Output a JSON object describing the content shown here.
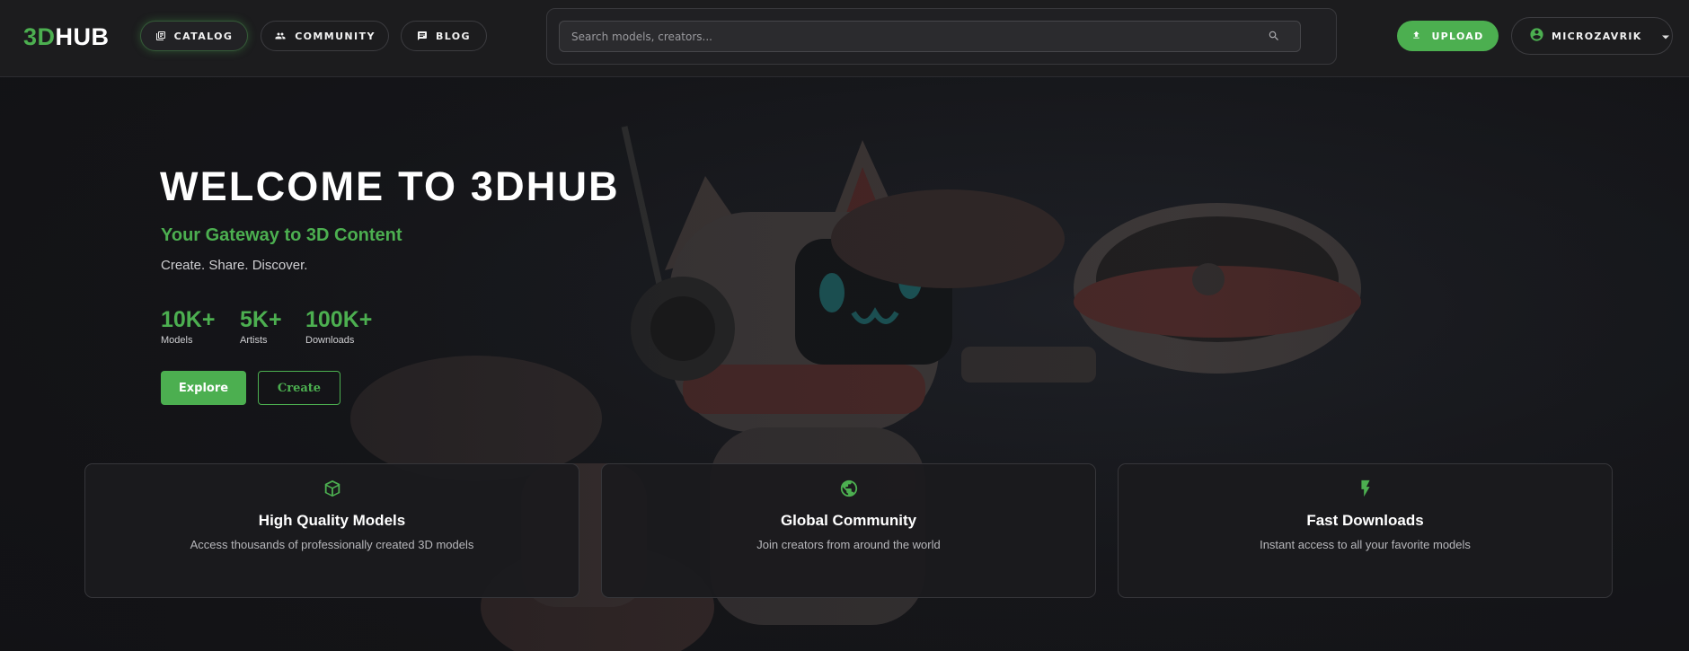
{
  "colors": {
    "accent": "#4caf50",
    "header_bg": "#1c1c1e",
    "page_bg": "#151518",
    "card_bg": "#1b1b1e",
    "text_muted": "#b7b7bb"
  },
  "header": {
    "logo": {
      "part1": "3D",
      "part2": "HUB"
    },
    "nav": [
      {
        "label": "CATALOG",
        "icon": "catalog-icon",
        "active": true
      },
      {
        "label": "COMMUNITY",
        "icon": "people-icon",
        "active": false
      },
      {
        "label": "BLOG",
        "icon": "comment-icon",
        "active": false
      }
    ],
    "search": {
      "placeholder": "Search models, creators...",
      "value": ""
    },
    "upload_label": "UPLOAD",
    "user": {
      "name": "MICROZAVRIK",
      "icon": "account-circle-icon"
    }
  },
  "hero": {
    "title": "WELCOME TO 3DHUB",
    "subtitle": "Your Gateway to 3D Content",
    "tagline": "Create. Share. Discover.",
    "stats": [
      {
        "value": "10K+",
        "label": "Models"
      },
      {
        "value": "5K+",
        "label": "Artists"
      },
      {
        "value": "100K+",
        "label": "Downloads"
      }
    ],
    "explore_label": "Explore",
    "create_label": "Create"
  },
  "features": [
    {
      "icon": "cube-icon",
      "title": "High Quality Models",
      "description": "Access thousands of professionally created 3D models"
    },
    {
      "icon": "globe-icon",
      "title": "Global Community",
      "description": "Join creators from around the world"
    },
    {
      "icon": "lightning-icon",
      "title": "Fast Downloads",
      "description": "Instant access to all your favorite models"
    }
  ]
}
